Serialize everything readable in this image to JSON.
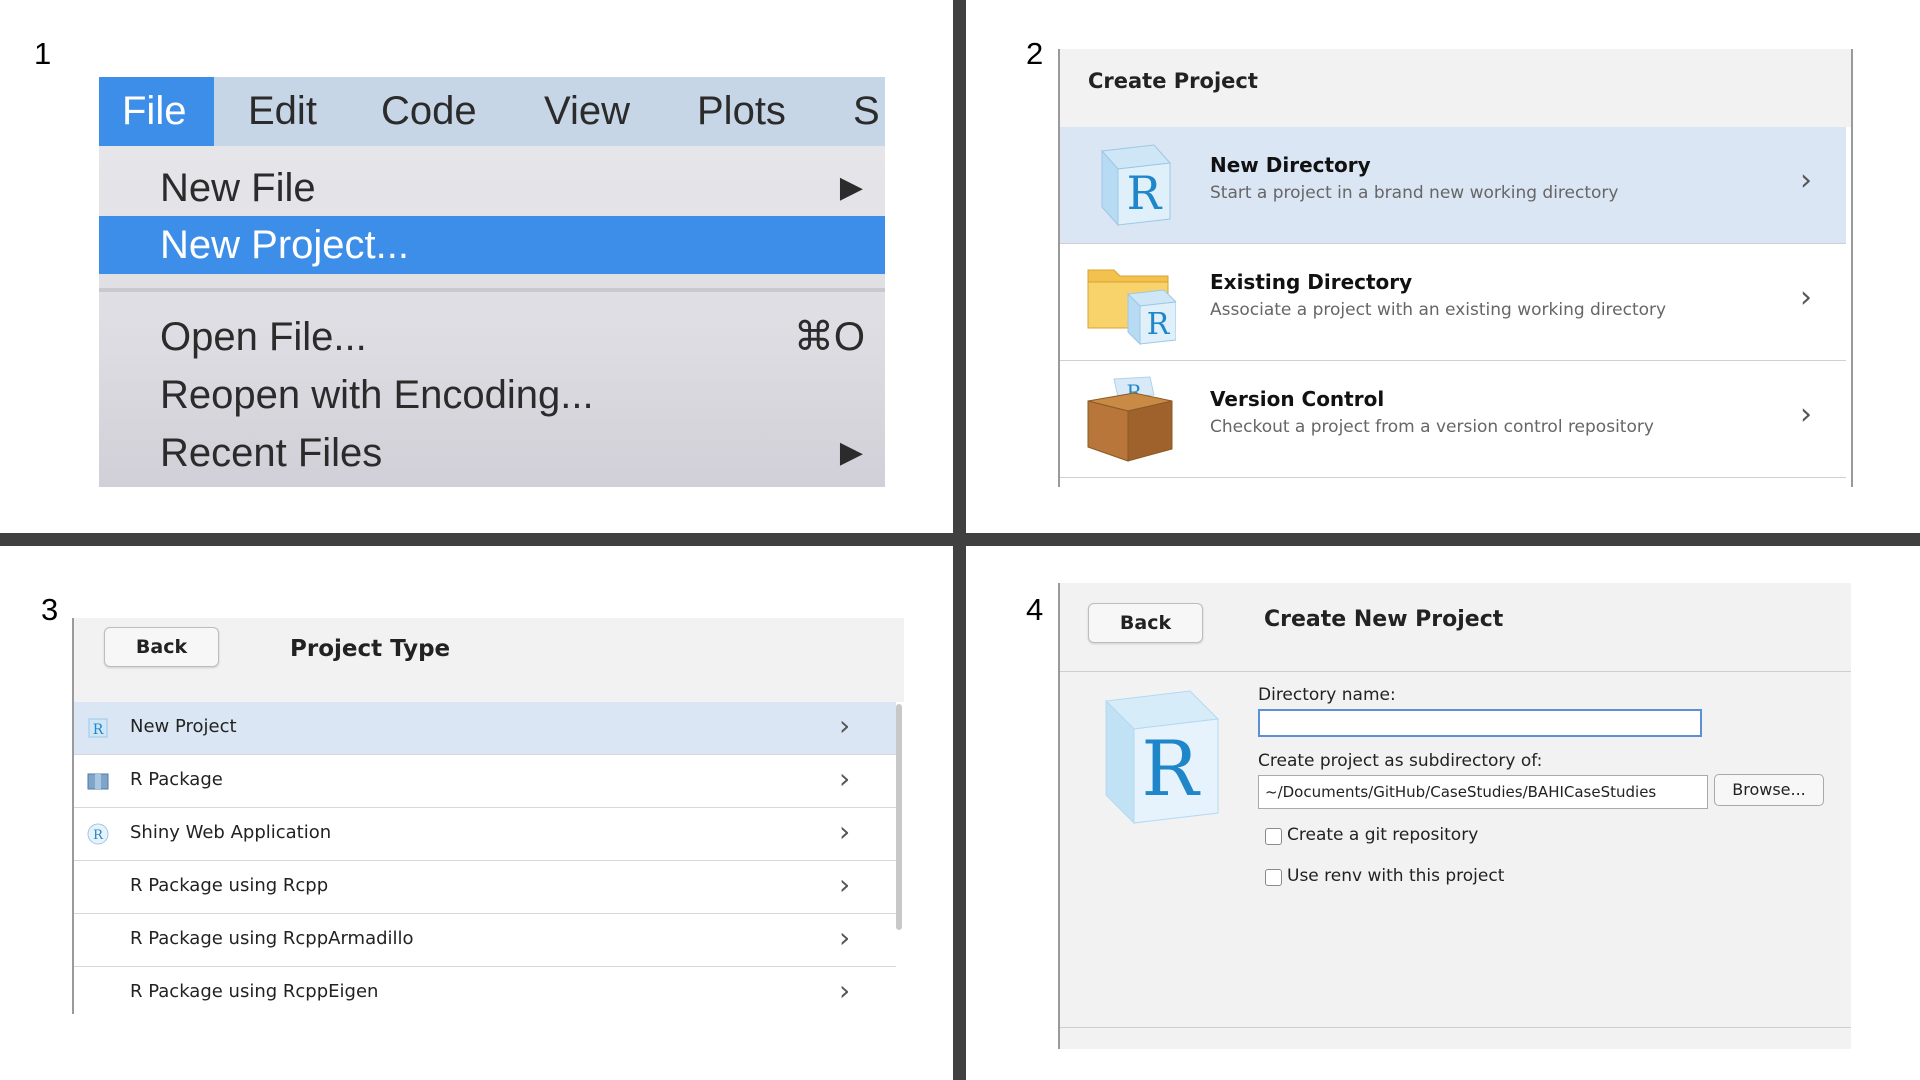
{
  "panel_numbers": [
    "1",
    "2",
    "3",
    "4"
  ],
  "menu": {
    "menubar": [
      "File",
      "Edit",
      "Code",
      "View",
      "Plots",
      "S"
    ],
    "items": [
      {
        "label": "New File",
        "right": "▶"
      },
      {
        "label": "New Project...",
        "right": ""
      },
      {
        "label": "Open File...",
        "right": "⌘O"
      },
      {
        "label": "Reopen with Encoding...",
        "right": ""
      },
      {
        "label": "Recent Files",
        "right": "▶"
      }
    ]
  },
  "create_project": {
    "title": "Create Project",
    "options": [
      {
        "title": "New Directory",
        "subtitle": "Start a project in a brand new working directory",
        "icon": "r-cube-icon"
      },
      {
        "title": "Existing Directory",
        "subtitle": "Associate a project with an existing working directory",
        "icon": "folder-r-icon"
      },
      {
        "title": "Version Control",
        "subtitle": "Checkout a project from a version control repository",
        "icon": "box-icon"
      }
    ],
    "chevron": "›"
  },
  "project_type": {
    "back_label": "Back",
    "title": "Project Type",
    "items": [
      {
        "label": "New Project",
        "icon": "r-project-icon"
      },
      {
        "label": "R Package",
        "icon": "r-package-icon"
      },
      {
        "label": "Shiny Web Application",
        "icon": "shiny-icon"
      },
      {
        "label": "R Package using Rcpp",
        "icon": ""
      },
      {
        "label": "R Package using RcppArmadillo",
        "icon": ""
      },
      {
        "label": "R Package using RcppEigen",
        "icon": ""
      }
    ],
    "chevron": "›"
  },
  "create_new_project": {
    "back_label": "Back",
    "title": "Create New Project",
    "directory_name_label": "Directory name:",
    "directory_name_value": "",
    "subdirectory_label": "Create project as subdirectory of:",
    "subdirectory_value": "~/Documents/GitHub/CaseStudies/BAHICaseStudies",
    "browse_label": "Browse...",
    "git_label": "Create a git repository",
    "renv_label": "Use renv with this project"
  },
  "colors": {
    "accent": "#3d8ee8",
    "selection": "#dbe6f4",
    "divider": "#404040"
  }
}
